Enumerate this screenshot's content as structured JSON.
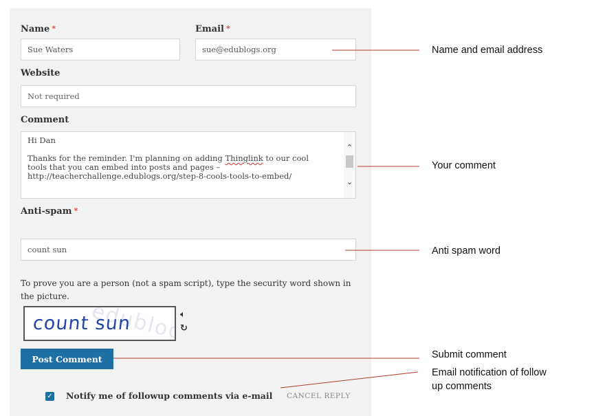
{
  "form": {
    "name": {
      "label": "Name",
      "required_mark": "*",
      "value": "Sue Waters"
    },
    "email": {
      "label": "Email",
      "required_mark": "*",
      "value": "sue@edublogs.org"
    },
    "website": {
      "label": "Website",
      "placeholder": "Not required"
    },
    "comment": {
      "label": "Comment",
      "lines": [
        "Hi Dan",
        "",
        "Thanks for the reminder. I'm planning on adding ",
        "Thinglink",
        " to our cool",
        "tools that you can embed into posts and pages –",
        "http://teacherchallenge.edublogs.org/step-8-cools-tools-to-embed/"
      ]
    },
    "antispam": {
      "label": "Anti-spam",
      "required_mark": "*",
      "value": "count sun"
    },
    "help_text": "To prove you are a person (not a spam script), type the security word shown in the picture.",
    "captcha": {
      "word": "count sun",
      "noise": "edublogs"
    },
    "submit_label": "Post Comment",
    "notify": {
      "checked": true,
      "label": "Notify me of followup comments via e-mail"
    },
    "cancel_label": "CANCEL REPLY"
  },
  "annotations": {
    "name_email": "Name and email address",
    "comment": "Your comment",
    "antispam": "Anti spam word",
    "submit": "Submit comment",
    "notify_line1": "Email notification of follow",
    "notify_line2": "up comments"
  },
  "colors": {
    "accent": "#1e6fa3",
    "required": "#d14b4b",
    "callout_line": "#b23a2e",
    "panel": "#f2f2f2"
  },
  "icons": {
    "checkbox": "check-icon",
    "audio": "speaker-icon",
    "refresh": "refresh-icon"
  }
}
